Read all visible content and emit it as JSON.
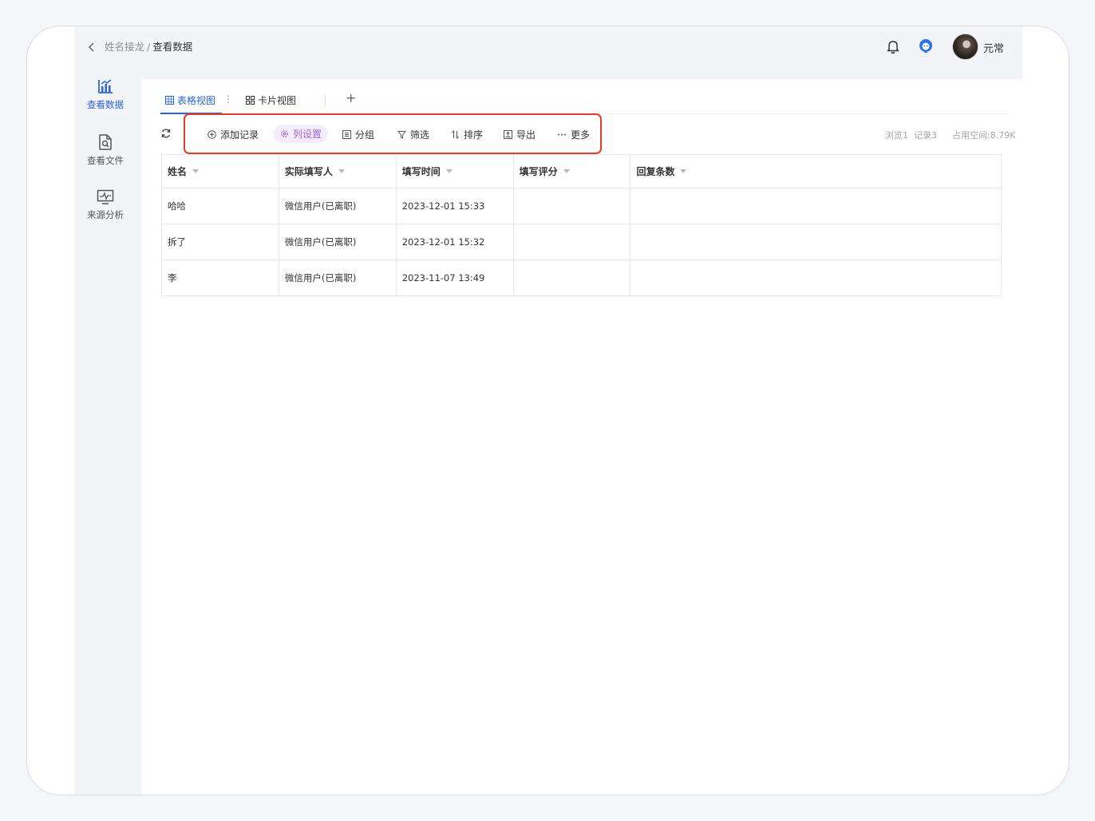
{
  "breadcrumb": {
    "parent": "姓名接龙",
    "separator": "/",
    "current": "查看数据"
  },
  "user": {
    "name": "元常"
  },
  "sidebar": {
    "items": [
      {
        "label": "查看数据",
        "icon": "bar-chart-icon",
        "active": true
      },
      {
        "label": "查看文件",
        "icon": "file-search-icon",
        "active": false
      },
      {
        "label": "来源分析",
        "icon": "monitor-chart-icon",
        "active": false
      }
    ]
  },
  "tabs": {
    "items": [
      {
        "label": "表格视图",
        "icon": "table-grid-icon",
        "active": true
      },
      {
        "label": "卡片视图",
        "icon": "card-grid-icon",
        "active": false
      }
    ],
    "more": "⋮",
    "add": "+"
  },
  "toolbar": {
    "items": [
      {
        "label": "添加记录",
        "icon": "plus-circle-icon"
      },
      {
        "label": "列设置",
        "icon": "settings-icon"
      },
      {
        "label": "分组",
        "icon": "group-icon"
      },
      {
        "label": "筛选",
        "icon": "filter-icon"
      },
      {
        "label": "排序",
        "icon": "sort-icon"
      },
      {
        "label": "导出",
        "icon": "export-icon"
      },
      {
        "label": "更多",
        "icon": "more-dots-icon"
      }
    ],
    "stats": {
      "views": "浏览1",
      "records": "记录3",
      "storage": "占用空间:8.79K"
    }
  },
  "table": {
    "columns": [
      "姓名",
      "实际填写人",
      "填写时间",
      "填写评分",
      "回复条数"
    ],
    "rows": [
      [
        "哈哈",
        "微信用户(已离职)",
        "2023-12-01 15:33",
        "",
        ""
      ],
      [
        "拆了",
        "微信用户(已离职)",
        "2023-12-01 15:32",
        "",
        ""
      ],
      [
        "李",
        "微信用户(已离职)",
        "2023-11-07 13:49",
        "",
        ""
      ]
    ]
  },
  "colors": {
    "accent": "#2c63d6",
    "highlight_border": "#e23d2c",
    "pill_text": "#a464d8",
    "pill_bg": "#f4ecfb"
  }
}
